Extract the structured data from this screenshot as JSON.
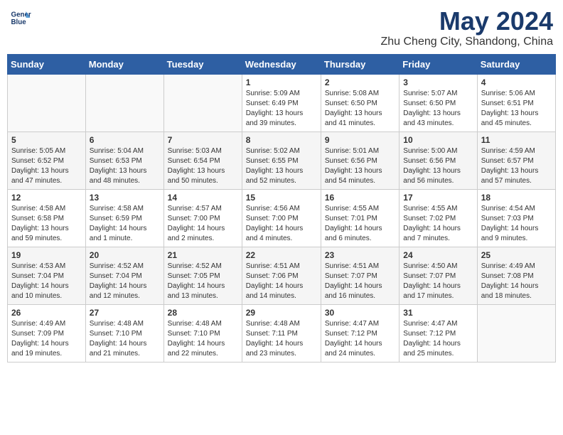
{
  "header": {
    "logo_line1": "General",
    "logo_line2": "Blue",
    "month": "May 2024",
    "location": "Zhu Cheng City, Shandong, China"
  },
  "days_of_week": [
    "Sunday",
    "Monday",
    "Tuesday",
    "Wednesday",
    "Thursday",
    "Friday",
    "Saturday"
  ],
  "weeks": [
    [
      {
        "day": "",
        "info": ""
      },
      {
        "day": "",
        "info": ""
      },
      {
        "day": "",
        "info": ""
      },
      {
        "day": "1",
        "info": "Sunrise: 5:09 AM\nSunset: 6:49 PM\nDaylight: 13 hours\nand 39 minutes."
      },
      {
        "day": "2",
        "info": "Sunrise: 5:08 AM\nSunset: 6:50 PM\nDaylight: 13 hours\nand 41 minutes."
      },
      {
        "day": "3",
        "info": "Sunrise: 5:07 AM\nSunset: 6:50 PM\nDaylight: 13 hours\nand 43 minutes."
      },
      {
        "day": "4",
        "info": "Sunrise: 5:06 AM\nSunset: 6:51 PM\nDaylight: 13 hours\nand 45 minutes."
      }
    ],
    [
      {
        "day": "5",
        "info": "Sunrise: 5:05 AM\nSunset: 6:52 PM\nDaylight: 13 hours\nand 47 minutes."
      },
      {
        "day": "6",
        "info": "Sunrise: 5:04 AM\nSunset: 6:53 PM\nDaylight: 13 hours\nand 48 minutes."
      },
      {
        "day": "7",
        "info": "Sunrise: 5:03 AM\nSunset: 6:54 PM\nDaylight: 13 hours\nand 50 minutes."
      },
      {
        "day": "8",
        "info": "Sunrise: 5:02 AM\nSunset: 6:55 PM\nDaylight: 13 hours\nand 52 minutes."
      },
      {
        "day": "9",
        "info": "Sunrise: 5:01 AM\nSunset: 6:56 PM\nDaylight: 13 hours\nand 54 minutes."
      },
      {
        "day": "10",
        "info": "Sunrise: 5:00 AM\nSunset: 6:56 PM\nDaylight: 13 hours\nand 56 minutes."
      },
      {
        "day": "11",
        "info": "Sunrise: 4:59 AM\nSunset: 6:57 PM\nDaylight: 13 hours\nand 57 minutes."
      }
    ],
    [
      {
        "day": "12",
        "info": "Sunrise: 4:58 AM\nSunset: 6:58 PM\nDaylight: 13 hours\nand 59 minutes."
      },
      {
        "day": "13",
        "info": "Sunrise: 4:58 AM\nSunset: 6:59 PM\nDaylight: 14 hours\nand 1 minute."
      },
      {
        "day": "14",
        "info": "Sunrise: 4:57 AM\nSunset: 7:00 PM\nDaylight: 14 hours\nand 2 minutes."
      },
      {
        "day": "15",
        "info": "Sunrise: 4:56 AM\nSunset: 7:00 PM\nDaylight: 14 hours\nand 4 minutes."
      },
      {
        "day": "16",
        "info": "Sunrise: 4:55 AM\nSunset: 7:01 PM\nDaylight: 14 hours\nand 6 minutes."
      },
      {
        "day": "17",
        "info": "Sunrise: 4:55 AM\nSunset: 7:02 PM\nDaylight: 14 hours\nand 7 minutes."
      },
      {
        "day": "18",
        "info": "Sunrise: 4:54 AM\nSunset: 7:03 PM\nDaylight: 14 hours\nand 9 minutes."
      }
    ],
    [
      {
        "day": "19",
        "info": "Sunrise: 4:53 AM\nSunset: 7:04 PM\nDaylight: 14 hours\nand 10 minutes."
      },
      {
        "day": "20",
        "info": "Sunrise: 4:52 AM\nSunset: 7:04 PM\nDaylight: 14 hours\nand 12 minutes."
      },
      {
        "day": "21",
        "info": "Sunrise: 4:52 AM\nSunset: 7:05 PM\nDaylight: 14 hours\nand 13 minutes."
      },
      {
        "day": "22",
        "info": "Sunrise: 4:51 AM\nSunset: 7:06 PM\nDaylight: 14 hours\nand 14 minutes."
      },
      {
        "day": "23",
        "info": "Sunrise: 4:51 AM\nSunset: 7:07 PM\nDaylight: 14 hours\nand 16 minutes."
      },
      {
        "day": "24",
        "info": "Sunrise: 4:50 AM\nSunset: 7:07 PM\nDaylight: 14 hours\nand 17 minutes."
      },
      {
        "day": "25",
        "info": "Sunrise: 4:49 AM\nSunset: 7:08 PM\nDaylight: 14 hours\nand 18 minutes."
      }
    ],
    [
      {
        "day": "26",
        "info": "Sunrise: 4:49 AM\nSunset: 7:09 PM\nDaylight: 14 hours\nand 19 minutes."
      },
      {
        "day": "27",
        "info": "Sunrise: 4:48 AM\nSunset: 7:10 PM\nDaylight: 14 hours\nand 21 minutes."
      },
      {
        "day": "28",
        "info": "Sunrise: 4:48 AM\nSunset: 7:10 PM\nDaylight: 14 hours\nand 22 minutes."
      },
      {
        "day": "29",
        "info": "Sunrise: 4:48 AM\nSunset: 7:11 PM\nDaylight: 14 hours\nand 23 minutes."
      },
      {
        "day": "30",
        "info": "Sunrise: 4:47 AM\nSunset: 7:12 PM\nDaylight: 14 hours\nand 24 minutes."
      },
      {
        "day": "31",
        "info": "Sunrise: 4:47 AM\nSunset: 7:12 PM\nDaylight: 14 hours\nand 25 minutes."
      },
      {
        "day": "",
        "info": ""
      }
    ]
  ]
}
